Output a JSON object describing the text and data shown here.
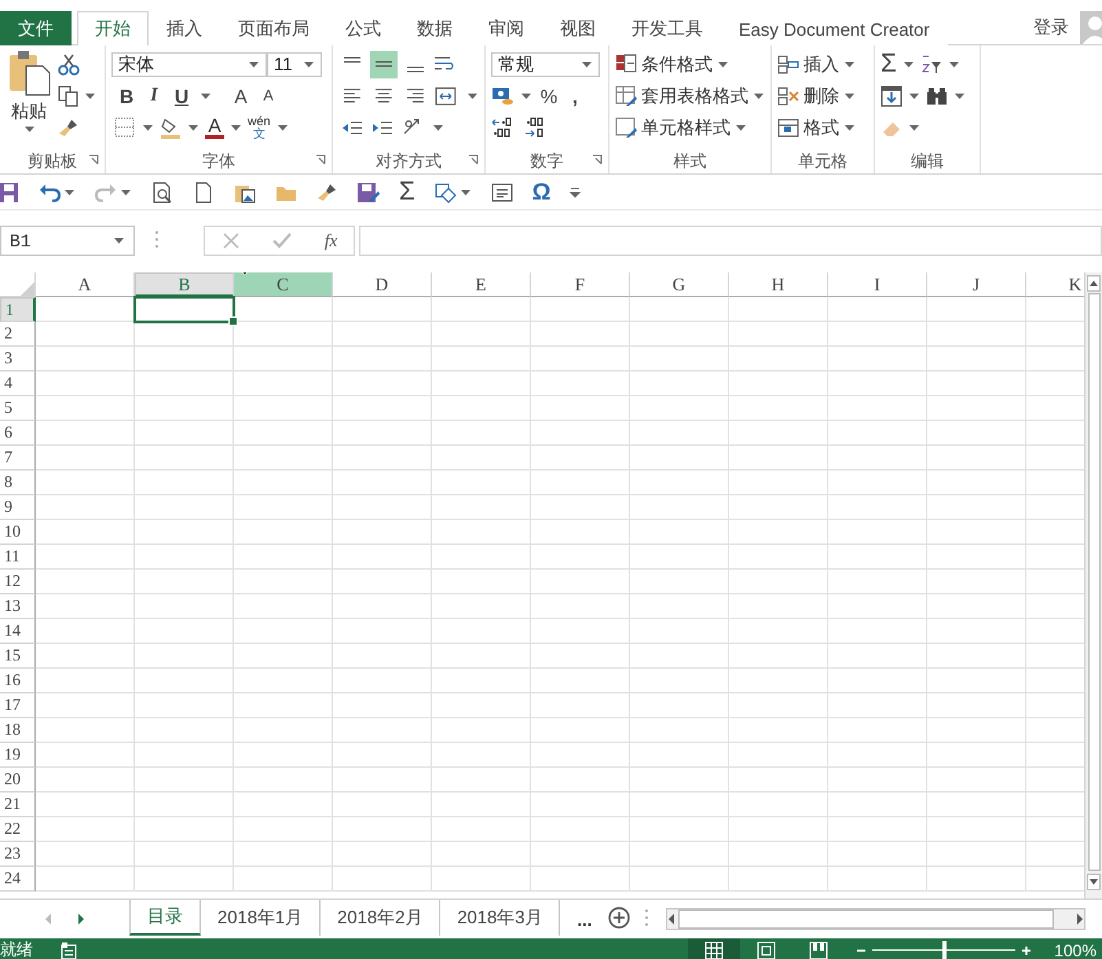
{
  "tabs": [
    {
      "label": "文件",
      "kind": "file",
      "selected": false
    },
    {
      "label": "开始",
      "kind": "tab",
      "selected": true
    },
    {
      "label": "插入",
      "kind": "tab",
      "selected": false
    },
    {
      "label": "页面布局",
      "kind": "tab",
      "selected": false
    },
    {
      "label": "公式",
      "kind": "tab",
      "selected": false
    },
    {
      "label": "数据",
      "kind": "tab",
      "selected": false
    },
    {
      "label": "审阅",
      "kind": "tab",
      "selected": false
    },
    {
      "label": "视图",
      "kind": "tab",
      "selected": false
    },
    {
      "label": "开发工具",
      "kind": "tab",
      "selected": false
    },
    {
      "label": "Easy Document Creator",
      "kind": "tab",
      "selected": false
    }
  ],
  "account": {
    "label": "登录"
  },
  "ribbon": {
    "clipboard": {
      "label": "剪贴板",
      "paste": "粘贴"
    },
    "font": {
      "label": "字体",
      "font_name": "宋体",
      "font_size": "11",
      "bold": "B",
      "italic": "I",
      "underline": "U",
      "grow": "A",
      "shrink": "A",
      "font_color": "A",
      "phonetic": "wén",
      "phonetic_mark": "文"
    },
    "alignment": {
      "label": "对齐方式",
      "vertical": [
        {
          "selected": false
        },
        {
          "selected": true
        },
        {
          "selected": false
        }
      ]
    },
    "number": {
      "label": "数字",
      "format": "常规",
      "percent": "%",
      "comma": ","
    },
    "styles": {
      "label": "样式",
      "buttons": [
        "条件格式",
        "套用表格格式",
        "单元格样式"
      ]
    },
    "cells": {
      "label": "单元格",
      "buttons": [
        "插入",
        "删除",
        "格式"
      ]
    },
    "editing": {
      "label": "编辑",
      "sum": "Σ"
    }
  },
  "quick_access": {
    "sum": "Σ",
    "symbol": "Ω"
  },
  "formula_bar": {
    "name_box": "B1",
    "function": "fx"
  },
  "columns": [
    {
      "label": "A",
      "selected": false,
      "hover": false
    },
    {
      "label": "B",
      "selected": true,
      "hover": false
    },
    {
      "label": "C",
      "selected": false,
      "hover": true
    },
    {
      "label": "D",
      "selected": false,
      "hover": false
    },
    {
      "label": "E",
      "selected": false,
      "hover": false
    },
    {
      "label": "F",
      "selected": false,
      "hover": false
    },
    {
      "label": "G",
      "selected": false,
      "hover": false
    },
    {
      "label": "H",
      "selected": false,
      "hover": false
    },
    {
      "label": "I",
      "selected": false,
      "hover": false
    },
    {
      "label": "J",
      "selected": false,
      "hover": false
    },
    {
      "label": "K",
      "selected": false,
      "hover": false
    }
  ],
  "rows": [
    {
      "label": "1",
      "selected": true
    },
    {
      "label": "2",
      "selected": false
    },
    {
      "label": "3",
      "selected": false
    },
    {
      "label": "4",
      "selected": false
    },
    {
      "label": "5",
      "selected": false
    },
    {
      "label": "6",
      "selected": false
    },
    {
      "label": "7",
      "selected": false
    },
    {
      "label": "8",
      "selected": false
    },
    {
      "label": "9",
      "selected": false
    },
    {
      "label": "10",
      "selected": false
    },
    {
      "label": "11",
      "selected": false
    },
    {
      "label": "12",
      "selected": false
    },
    {
      "label": "13",
      "selected": false
    },
    {
      "label": "14",
      "selected": false
    },
    {
      "label": "15",
      "selected": false
    },
    {
      "label": "16",
      "selected": false
    },
    {
      "label": "17",
      "selected": false
    },
    {
      "label": "18",
      "selected": false
    },
    {
      "label": "19",
      "selected": false
    },
    {
      "label": "20",
      "selected": false
    },
    {
      "label": "21",
      "selected": false
    },
    {
      "label": "22",
      "selected": false
    },
    {
      "label": "23",
      "selected": false
    },
    {
      "label": "24",
      "selected": false
    }
  ],
  "sheets": {
    "tabs": [
      {
        "label": "目录",
        "selected": true
      },
      {
        "label": "2018年1月",
        "selected": false
      },
      {
        "label": "2018年2月",
        "selected": false
      },
      {
        "label": "2018年3月",
        "selected": false
      }
    ],
    "more": "..."
  },
  "status_bar": {
    "status": "就绪",
    "views": [
      {
        "selected": true
      },
      {
        "selected": false
      },
      {
        "selected": false
      }
    ],
    "zoom": {
      "level": 0.5
    },
    "zoom_text": "100%"
  }
}
